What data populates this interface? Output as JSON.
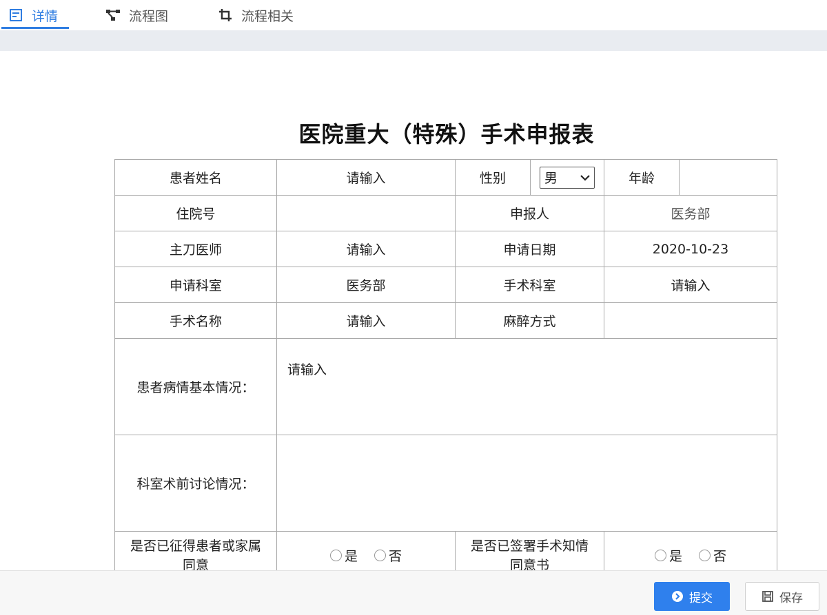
{
  "tabs": [
    {
      "label": "详情",
      "icon": "detail-icon",
      "active": true
    },
    {
      "label": "流程图",
      "icon": "flowchart-icon",
      "active": false
    },
    {
      "label": "流程相关",
      "icon": "crop-icon",
      "active": false
    }
  ],
  "form": {
    "title": "医院重大（特殊）手术申报表",
    "patient_name": {
      "label": "患者姓名",
      "placeholder": "请输入"
    },
    "gender": {
      "label": "性别",
      "value": "男"
    },
    "age": {
      "label": "年龄",
      "value": ""
    },
    "admission_no": {
      "label": "住院号",
      "value": ""
    },
    "reporter": {
      "label": "申报人",
      "value": "医务部"
    },
    "surgeon": {
      "label": "主刀医师",
      "placeholder": "请输入"
    },
    "apply_date": {
      "label": "申请日期",
      "value": "2020-10-23"
    },
    "apply_dept": {
      "label": "申请科室",
      "value": "医务部"
    },
    "surgery_dept": {
      "label": "手术科室",
      "placeholder": "请输入"
    },
    "surgery_name": {
      "label": "手术名称",
      "placeholder": "请输入"
    },
    "anesthesia": {
      "label": "麻醉方式",
      "value": ""
    },
    "condition": {
      "label": "患者病情基本情况：",
      "placeholder": "请输入"
    },
    "discussion": {
      "label": "科室术前讨论情况：",
      "value": ""
    },
    "consent": {
      "label_line1": "是否已征得患者或家属",
      "label_line2": "同意",
      "yes": "是",
      "no": "否"
    },
    "informed": {
      "label_line1": "是否已签署手术知情",
      "label_line2": "同意书",
      "yes": "是",
      "no": "否"
    }
  },
  "footer": {
    "submit_label": "提交",
    "save_label": "保存"
  },
  "colors": {
    "accent": "#2f7de1",
    "button": "#2f80ed"
  }
}
